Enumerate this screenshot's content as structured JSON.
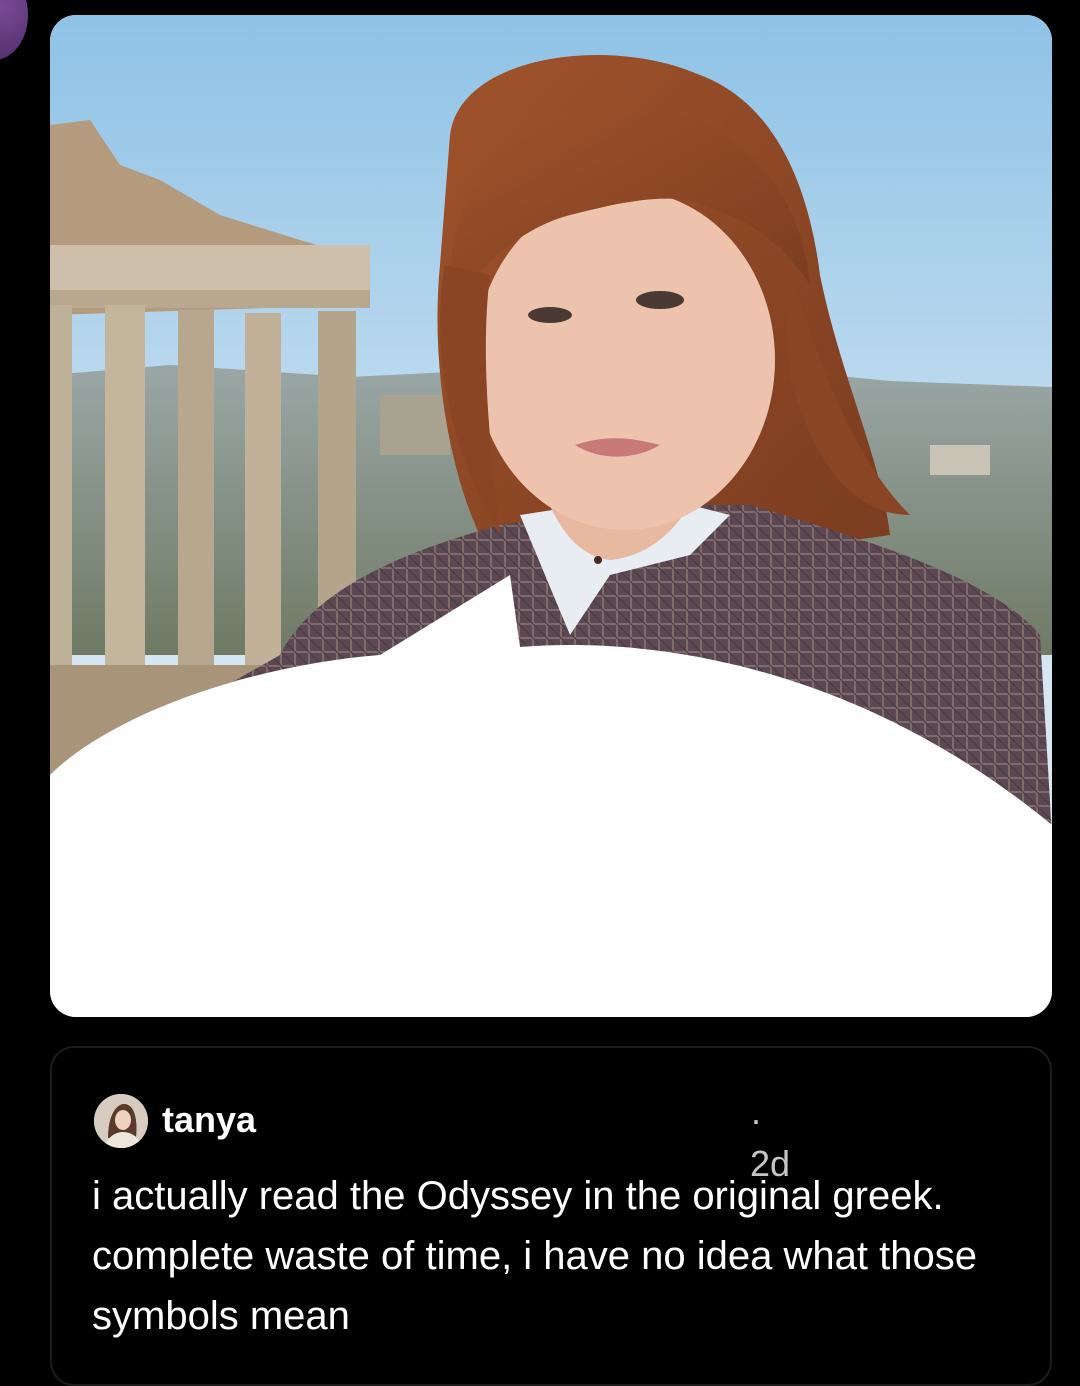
{
  "theme": {
    "background": "#000000",
    "text": "#ffffff",
    "muted_text": "#c6c6c6",
    "card_border": "#1c1c1c",
    "corner_avatar": "#6a3f86"
  },
  "image_post": {
    "image_description": "photo of a woman with auburn hair and bangs in a plaid blazer standing in front of ancient Roman columns, lower area covered by a white blob",
    "icon": "photo"
  },
  "reply": {
    "author": "tanya",
    "timestamp": "· 2d",
    "text": "i actually read the Odyssey in the original greek. complete waste of time, i have no idea what those symbols mean",
    "avatar_icon": "user-avatar"
  }
}
